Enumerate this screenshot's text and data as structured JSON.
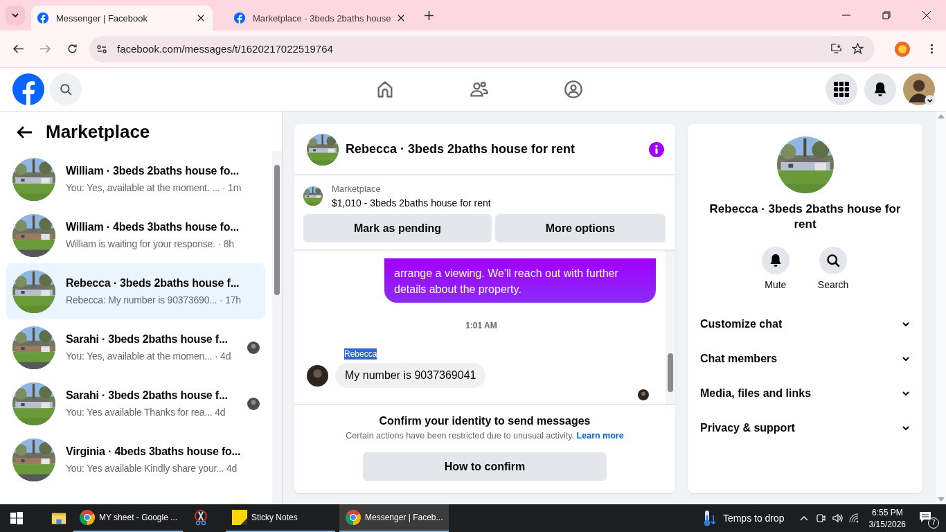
{
  "browser": {
    "tabs": [
      {
        "title": "Messenger | Facebook",
        "selected": true
      },
      {
        "title": "Marketplace - 3beds 2baths house",
        "selected": false
      }
    ],
    "url": "facebook.com/messages/t/1620217022519764"
  },
  "sidebar": {
    "title": "Marketplace",
    "conversations": [
      {
        "title": "William · 3beds 2baths house fo...",
        "preview": "You: Yes, available at the moment. ...",
        "time": "· 1m",
        "selected": false,
        "read_receipt": false
      },
      {
        "title": "William · 4beds 3baths house fo...",
        "preview": "William is waiting for your response.",
        "time": "· 8h",
        "selected": false,
        "read_receipt": false
      },
      {
        "title": "Rebecca · 3beds 2baths house f...",
        "preview": "Rebecca: My number is 90373690...",
        "time": "· 17h",
        "selected": true,
        "read_receipt": false
      },
      {
        "title": "Sarahi · 3beds 2baths house f...",
        "preview": "You: Yes, available at the momen...",
        "time": "· 4d",
        "selected": false,
        "read_receipt": true
      },
      {
        "title": "Sarahi · 3beds 2baths house f...",
        "preview": "You: Yes available Thanks for rea...",
        "time": "4d",
        "selected": false,
        "read_receipt": true
      },
      {
        "title": "Virginia · 4beds 3baths house fo...",
        "preview": "You: Yes available Kindly share your...",
        "time": "4d",
        "selected": false,
        "read_receipt": false
      }
    ]
  },
  "chat": {
    "title": "Rebecca · 3beds 2baths house for rent",
    "listing": {
      "label": "Marketplace",
      "title": "$1,010 - 3beds 2baths house for rent"
    },
    "buttons": [
      "Mark as pending",
      "More options"
    ],
    "messages": [
      {
        "kind": "outgoing",
        "text": "arrange a viewing. We'll reach out with further details about the property."
      },
      {
        "kind": "timestamp",
        "text": "1:01 AM"
      },
      {
        "kind": "incoming",
        "sender": "Rebecca",
        "text": "My number is 9037369041"
      }
    ],
    "notice": {
      "title": "Confirm your identity to send messages",
      "body": "Certain actions have been restricted due to unusual activity.",
      "link": "Learn more",
      "button": "How to confirm"
    }
  },
  "details": {
    "title": "Rebecca · 3beds 2baths house for rent",
    "actions": [
      {
        "kind": "mute",
        "label": "Mute"
      },
      {
        "kind": "search",
        "label": "Search"
      }
    ],
    "sections": [
      "Customize chat",
      "Chat members",
      "Media, files and links",
      "Privacy & support"
    ]
  },
  "taskbar": {
    "apps": [
      {
        "kind": "chrome",
        "label": "MY sheet - Google ...",
        "active": false
      },
      {
        "kind": "snip",
        "active": false
      },
      {
        "kind": "sticky",
        "label": "Sticky Notes",
        "active": false
      },
      {
        "kind": "chrome",
        "label": "Messenger | Faceb...",
        "active": true
      }
    ],
    "weather": "Temps to drop",
    "time": "6:55 PM",
    "date": "3/15/2026",
    "notifications": "7"
  }
}
